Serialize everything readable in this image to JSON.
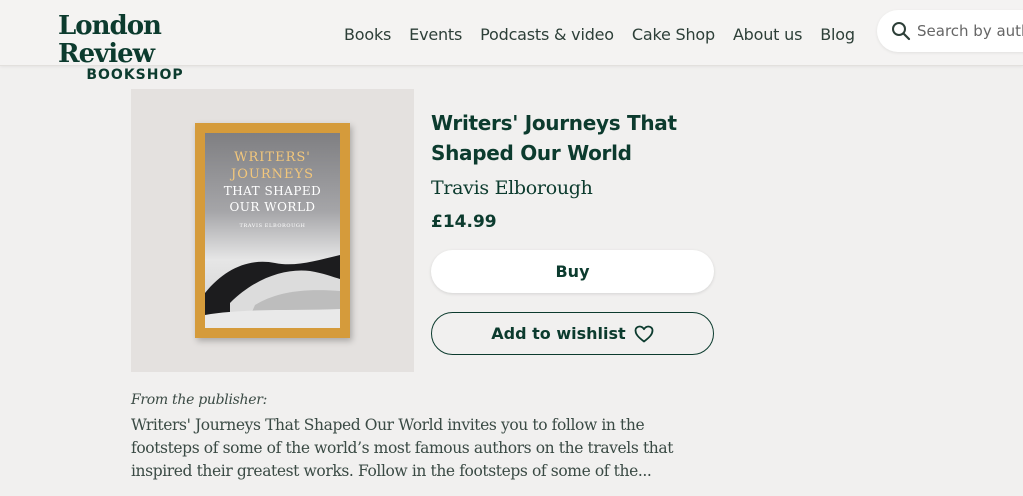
{
  "header": {
    "logo_main": "London Review",
    "logo_sub": "BOOKSHOP",
    "nav": [
      "Books",
      "Events",
      "Podcasts & video",
      "Cake Shop",
      "About us",
      "Blog"
    ],
    "search_placeholder": "Search by author"
  },
  "product": {
    "cover": {
      "title_line1": "WRITERS'",
      "title_line2": "JOURNEYS",
      "title_line3": "THAT SHAPED",
      "title_line4": "OUR WORLD",
      "author": "TRAVIS ELBOROUGH"
    },
    "title": "Writers' Journeys That Shaped Our World",
    "author": "Travis Elborough",
    "price": "£14.99",
    "buy_label": "Buy",
    "wishlist_label": "Add to wishlist"
  },
  "description": {
    "label": "From the publisher:",
    "text": "Writers' Journeys That Shaped Our World invites you to follow in the footsteps of some of the world’s most famous authors on the travels that inspired their greatest works. Follow in the footsteps of some of the..."
  },
  "colors": {
    "brand_green": "#0c3b2e",
    "background": "#f1f0ef",
    "cover_orange": "#d59b3b"
  }
}
